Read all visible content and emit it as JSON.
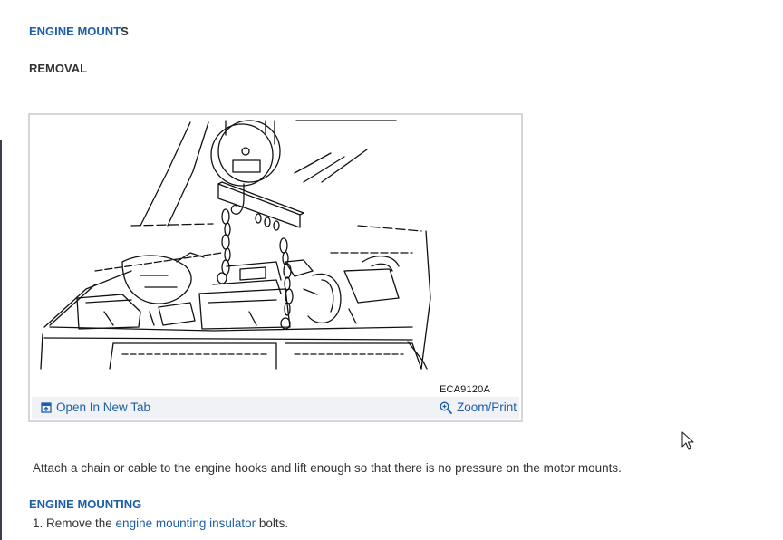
{
  "section": {
    "title_main": "ENGINE MOUNT",
    "title_tail": "S",
    "subtitle": "REMOVAL"
  },
  "figure": {
    "caption": "ECA9120A",
    "open_label": "Open In New Tab",
    "zoom_label": "Zoom/Print",
    "icons": [
      "open-in-new-tab-icon",
      "zoom-icon"
    ]
  },
  "instruction": "Attach a chain or cable to the engine hooks and lift enough so that there is no pressure on the motor mounts.",
  "mounting": {
    "title": "ENGINE MOUNTING",
    "step_prefix": "1. Remove the ",
    "step_link": "engine mounting insulator",
    "step_suffix": " bolts."
  },
  "colors": {
    "link": "#1f5fa6",
    "text": "#333333",
    "toolbar_bg": "#f1f2f5"
  }
}
